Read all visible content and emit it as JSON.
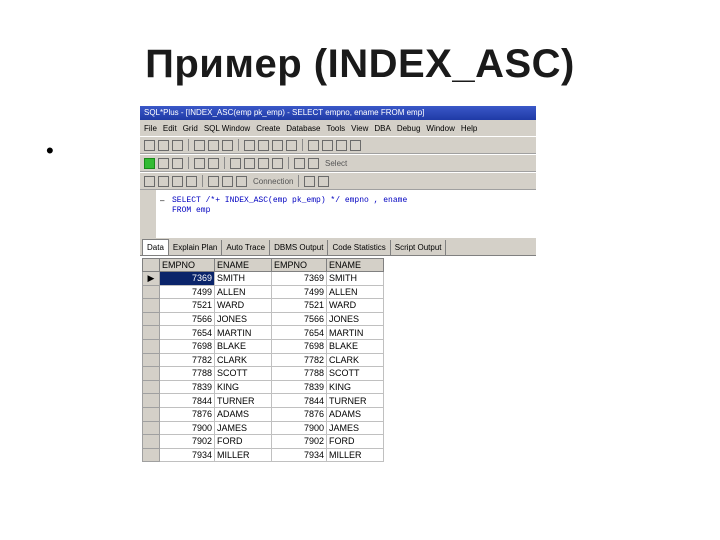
{
  "slide": {
    "title": "Пример (INDEX_ASC)",
    "bullet": "•"
  },
  "window": {
    "title": "SQL*Plus - [INDEX_ASC(emp pk_emp) - SELECT empno, ename FROM emp]"
  },
  "menubar": {
    "items": [
      "File",
      "Edit",
      "Grid",
      "SQL Window",
      "Create",
      "Database",
      "Tools",
      "View",
      "DBA",
      "Debug",
      "Window",
      "Help"
    ]
  },
  "toolbar": {
    "combo_text": "Select",
    "combo_text2": "Connection"
  },
  "editor": {
    "line1": "SELECT /*+ INDEX_ASC(emp pk_emp) */ empno , ename",
    "line2": "FROM emp"
  },
  "tabs": [
    "Data",
    "Explain Plan",
    "Auto Trace",
    "DBMS Output",
    "Code Statistics",
    "Script Output"
  ],
  "grid": {
    "columns": [
      "EMPNO",
      "ENAME",
      "EMPNO",
      "ENAME"
    ],
    "rows": [
      [
        "7369",
        "SMITH",
        "7369",
        "SMITH"
      ],
      [
        "7499",
        "ALLEN",
        "7499",
        "ALLEN"
      ],
      [
        "7521",
        "WARD",
        "7521",
        "WARD"
      ],
      [
        "7566",
        "JONES",
        "7566",
        "JONES"
      ],
      [
        "7654",
        "MARTIN",
        "7654",
        "MARTIN"
      ],
      [
        "7698",
        "BLAKE",
        "7698",
        "BLAKE"
      ],
      [
        "7782",
        "CLARK",
        "7782",
        "CLARK"
      ],
      [
        "7788",
        "SCOTT",
        "7788",
        "SCOTT"
      ],
      [
        "7839",
        "KING",
        "7839",
        "KING"
      ],
      [
        "7844",
        "TURNER",
        "7844",
        "TURNER"
      ],
      [
        "7876",
        "ADAMS",
        "7876",
        "ADAMS"
      ],
      [
        "7900",
        "JAMES",
        "7900",
        "JAMES"
      ],
      [
        "7902",
        "FORD",
        "7902",
        "FORD"
      ],
      [
        "7934",
        "MILLER",
        "7934",
        "MILLER"
      ]
    ],
    "row_indicator": "▶"
  }
}
